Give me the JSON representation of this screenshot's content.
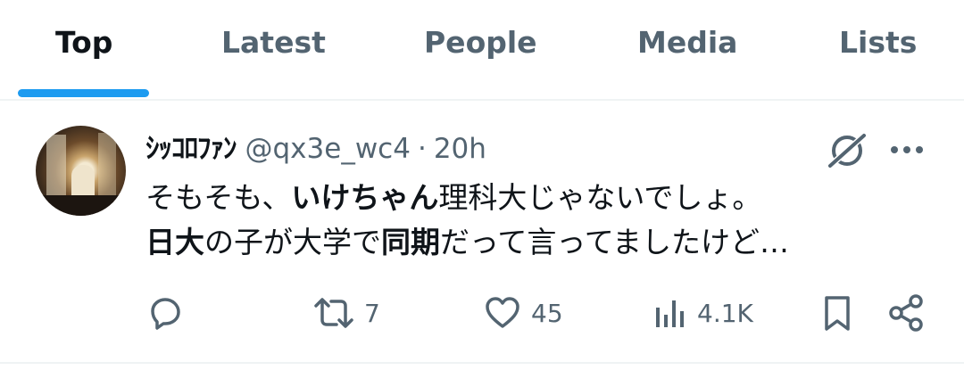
{
  "tabs": [
    {
      "label": "Top",
      "active": true
    },
    {
      "label": "Latest",
      "active": false
    },
    {
      "label": "People",
      "active": false
    },
    {
      "label": "Media",
      "active": false
    },
    {
      "label": "Lists",
      "active": false
    }
  ],
  "accent_color": "#1d9bf0",
  "tweet": {
    "display_name": "ｼｯｺﾛﾌｧﾝ",
    "handle": "@qx3e_wc4",
    "separator": "·",
    "time": "20h",
    "text_line1": {
      "pre": "そもそも、",
      "bold": "いけちゃん",
      "post": "理科大じゃないでしょ。"
    },
    "text_line2": {
      "bold1": "日大",
      "mid": "の子が大学で",
      "bold2": "同期",
      "post": "だって言ってましたけど…"
    },
    "actions": {
      "reply": {
        "icon": "reply-icon",
        "count": ""
      },
      "retweet": {
        "icon": "retweet-icon",
        "count": "7"
      },
      "like": {
        "icon": "heart-icon",
        "count": "45"
      },
      "views": {
        "icon": "views-icon",
        "count": "4.1K"
      },
      "bookmark": {
        "icon": "bookmark-icon"
      },
      "share": {
        "icon": "share-icon"
      }
    }
  }
}
